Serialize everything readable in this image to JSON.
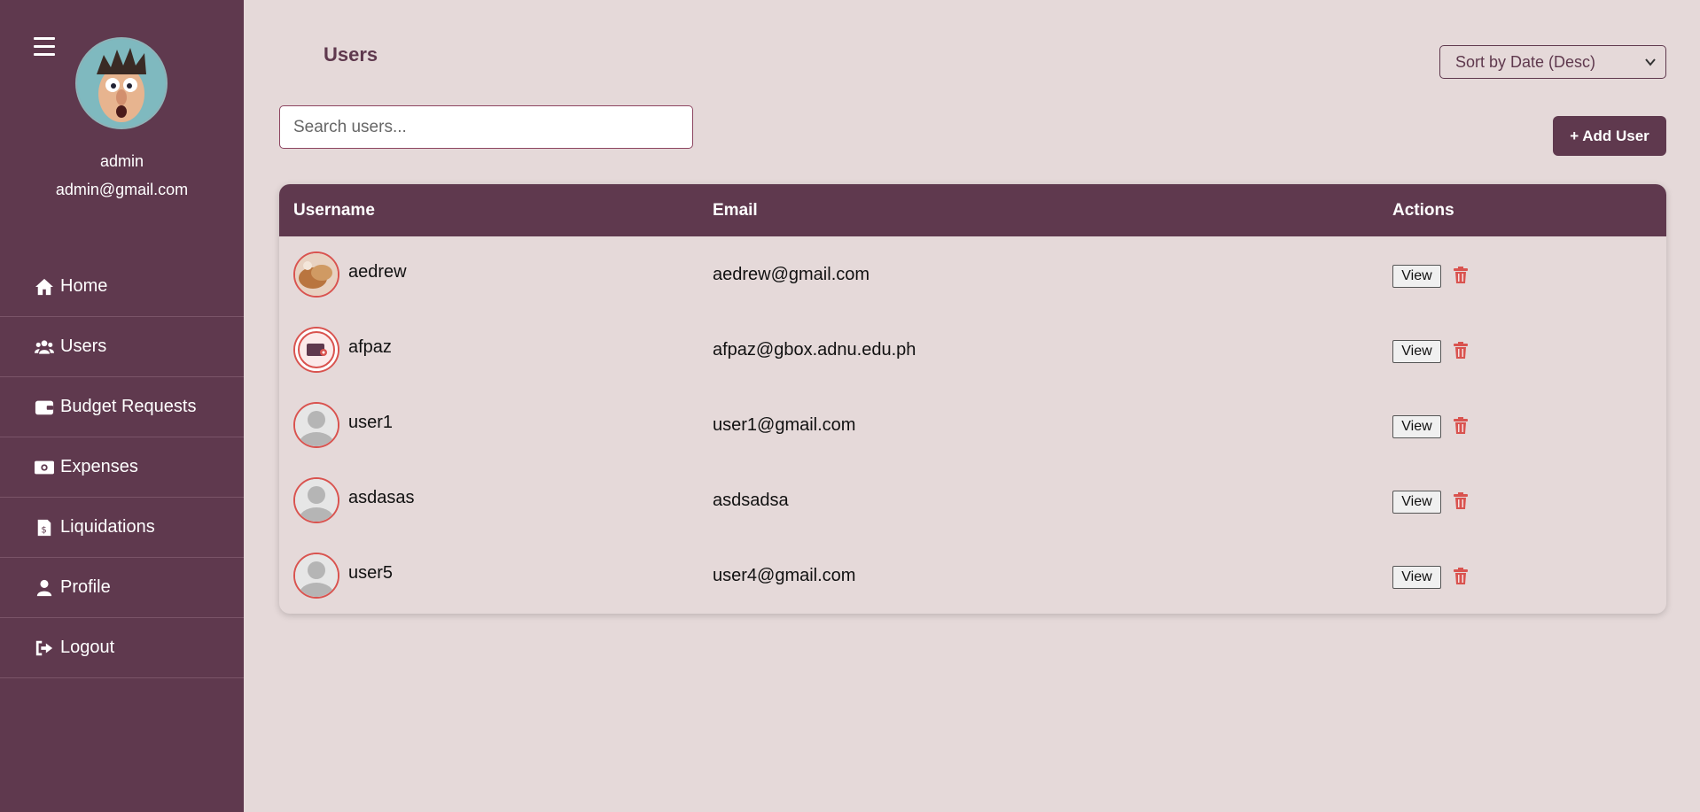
{
  "sidebar": {
    "username": "admin",
    "email": "admin@gmail.com",
    "items": [
      {
        "label": "Home",
        "icon": "home-icon"
      },
      {
        "label": "Users",
        "icon": "users-icon"
      },
      {
        "label": "Budget Requests",
        "icon": "wallet-icon"
      },
      {
        "label": "Expenses",
        "icon": "money-bill-icon"
      },
      {
        "label": "Liquidations",
        "icon": "receipt-icon"
      },
      {
        "label": "Profile",
        "icon": "user-icon"
      },
      {
        "label": "Logout",
        "icon": "logout-icon"
      }
    ]
  },
  "main": {
    "title": "Users",
    "sort": {
      "selected": "Sort by Date (Desc)"
    },
    "search": {
      "placeholder": "Search users...",
      "value": ""
    },
    "add_button": "+ Add User"
  },
  "table": {
    "headers": {
      "username": "Username",
      "email": "Email",
      "actions": "Actions"
    },
    "view_label": "View",
    "rows": [
      {
        "username": "aedrew",
        "email": "aedrew@gmail.com",
        "avatar": "photo-food"
      },
      {
        "username": "afpaz",
        "email": "afpaz@gbox.adnu.edu.ph",
        "avatar": "photo-icon"
      },
      {
        "username": "user1",
        "email": "user1@gmail.com",
        "avatar": "default"
      },
      {
        "username": "asdasas",
        "email": "asdsadsa",
        "avatar": "default"
      },
      {
        "username": "user5",
        "email": "user4@gmail.com",
        "avatar": "default"
      }
    ]
  },
  "colors": {
    "primary": "#5f394e",
    "background": "#e5d9d9",
    "danger": "#d9534f"
  }
}
